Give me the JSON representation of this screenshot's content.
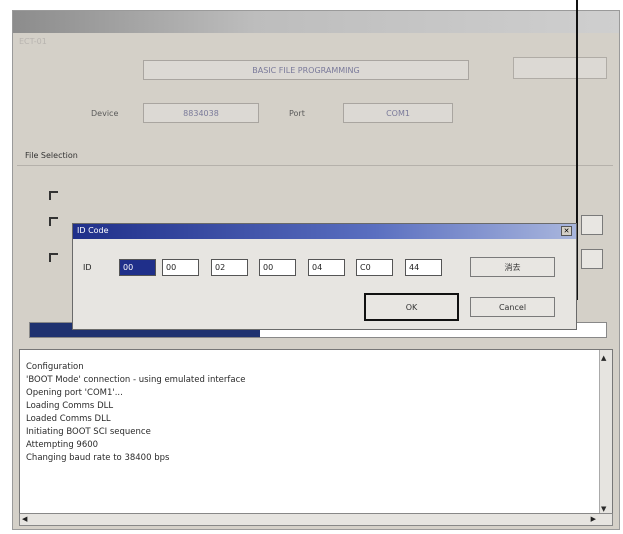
{
  "window": {
    "subtitle": "ECT-01",
    "header_title": "BASIC FILE PROGRAMMING",
    "device_label": "Device",
    "device_value": "8834038",
    "port_label": "Port",
    "port_value": "COM1",
    "file_selection_label": "File Selection",
    "progress_fraction": 0.4
  },
  "dialog": {
    "title": "ID Code",
    "id_label": "ID",
    "id_values": [
      "00",
      "00",
      "02",
      "00",
      "04",
      "C0",
      "44"
    ],
    "clear_button": "消去",
    "ok_button": "OK",
    "cancel_button": "Cancel"
  },
  "log": {
    "lines": [
      "Configuration",
      "'BOOT Mode' connection - using emulated interface",
      "Opening port 'COM1'...",
      "Loading Comms DLL",
      "Loaded Comms DLL",
      "Initiating BOOT SCI sequence",
      "Attempting 9600",
      "Changing baud rate to 38400 bps"
    ]
  }
}
